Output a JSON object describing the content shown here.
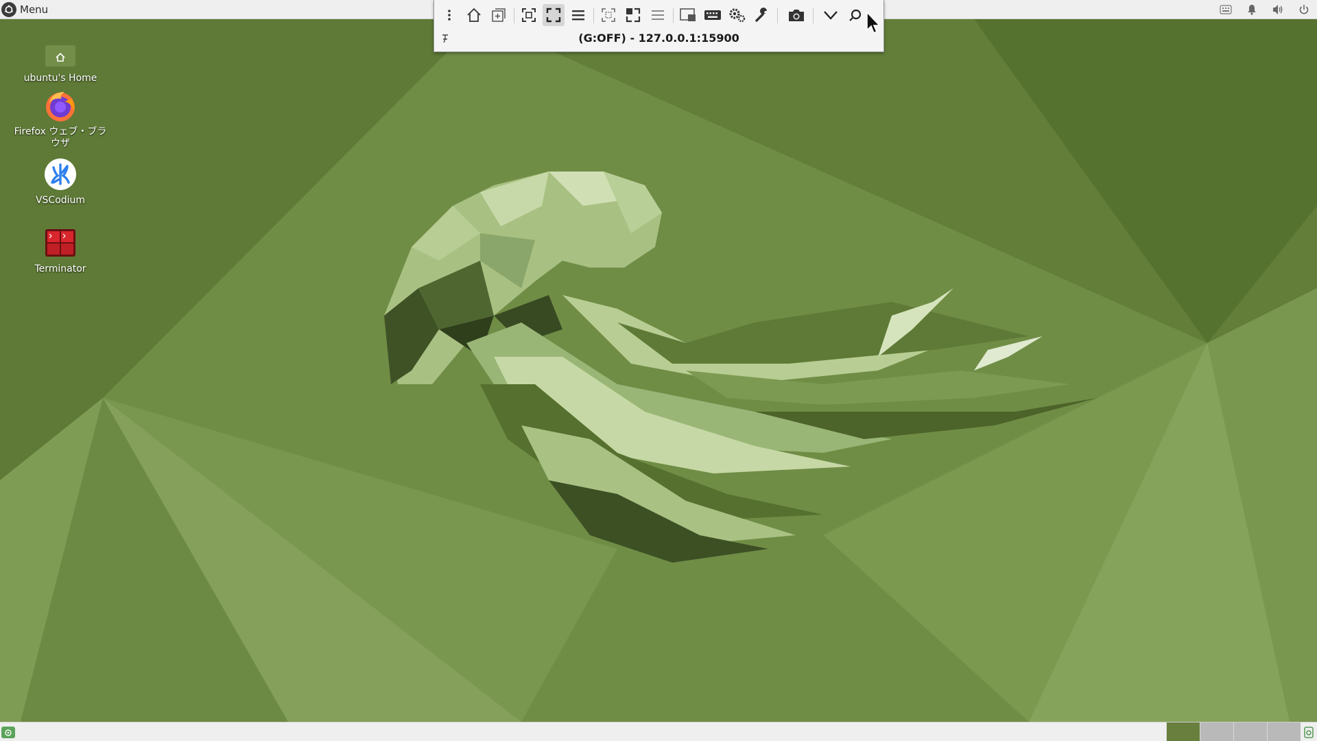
{
  "top_panel": {
    "menu_label": "Menu",
    "tray_icons": [
      "keyboard-icon",
      "notification-bell-icon",
      "volume-icon",
      "power-icon"
    ]
  },
  "desktop_icons": [
    {
      "name": "home-folder",
      "label": "ubuntu's Home",
      "icon": "home-folder-icon"
    },
    {
      "name": "firefox",
      "label": "Firefox ウェブ・ブラウザ",
      "icon": "firefox-icon"
    },
    {
      "name": "vscodium",
      "label": "VSCodium",
      "icon": "vscodium-icon"
    },
    {
      "name": "terminator",
      "label": "Terminator",
      "icon": "terminator-icon"
    }
  ],
  "remote_toolbar": {
    "title": "(G:OFF) - 127.0.0.1:15900",
    "buttons": [
      "menu-dots-icon",
      "home-icon",
      "new-connection-icon",
      "fit-window-icon",
      "fullscreen-icon",
      "toolbar-options-icon",
      "scaled-icon",
      "viewport-icon",
      "list-icon",
      "multi-monitor-icon",
      "keyboard-icon",
      "preferences-icon",
      "tools-icon",
      "screenshot-icon",
      "minimize-chevron-icon",
      "disconnect-icon"
    ],
    "active_button": "fullscreen-icon"
  },
  "bottom_panel": {
    "workspaces": 4,
    "active_workspace": 1
  },
  "colors": {
    "panel_bg": "#efefef",
    "wallpaper_base": "#6f8c45",
    "workspace_active": "#687f3e"
  }
}
